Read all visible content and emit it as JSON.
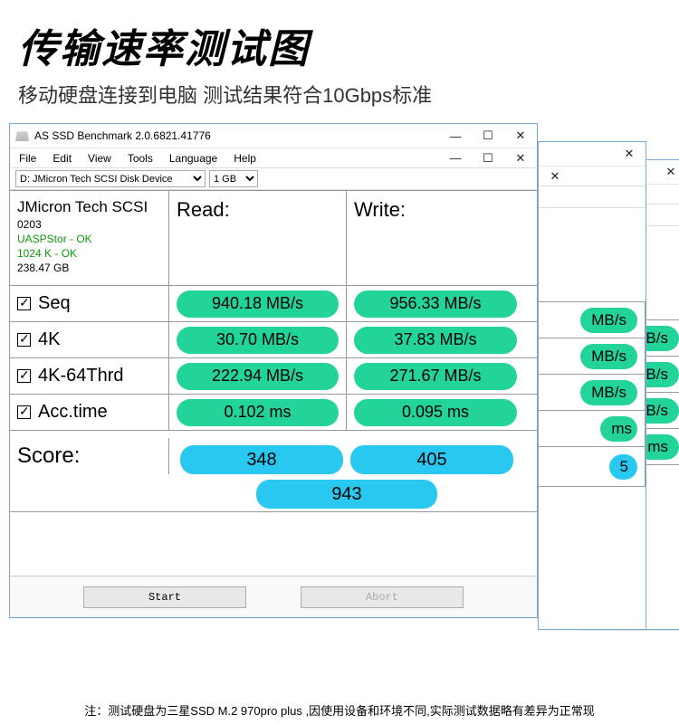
{
  "heading": {
    "title": "传输速率测试图",
    "subtitle": "移动硬盘连接到电脑 测试结果符合10Gbps标准"
  },
  "window": {
    "title": "AS SSD Benchmark 2.0.6821.41776"
  },
  "menu": {
    "file": "File",
    "edit": "Edit",
    "view": "View",
    "tools": "Tools",
    "language": "Language",
    "help": "Help"
  },
  "toolbar": {
    "device": "D: JMicron Tech SCSI Disk Device",
    "size": "1 GB"
  },
  "info": {
    "device": "JMicron Tech SCSI",
    "code": "0203",
    "uasp": "UASPStor - OK",
    "align": "1024 K - OK",
    "cap": "238.47 GB"
  },
  "headers": {
    "read": "Read:",
    "write": "Write:"
  },
  "rows": {
    "seq": {
      "label": "Seq",
      "read": "940.18 MB/s",
      "write": "956.33 MB/s"
    },
    "k4": {
      "label": "4K",
      "read": "30.70 MB/s",
      "write": "37.83 MB/s"
    },
    "k464": {
      "label": "4K-64Thrd",
      "read": "222.94 MB/s",
      "write": "271.67 MB/s"
    },
    "acc": {
      "label": "Acc.time",
      "read": "0.102 ms",
      "write": "0.095 ms"
    }
  },
  "score": {
    "label": "Score:",
    "read": "348",
    "write": "405",
    "total": "943"
  },
  "buttons": {
    "start": "Start",
    "abort": "Abort"
  },
  "bg": {
    "mbs": "MB/s",
    "ms": "ms",
    "s5": "5",
    "sms": "ms"
  },
  "footer": "注：测试硬盘为三星SSD M.2 970pro  plus ,因使用设备和环境不同,实际测试数据略有差异为正常现"
}
